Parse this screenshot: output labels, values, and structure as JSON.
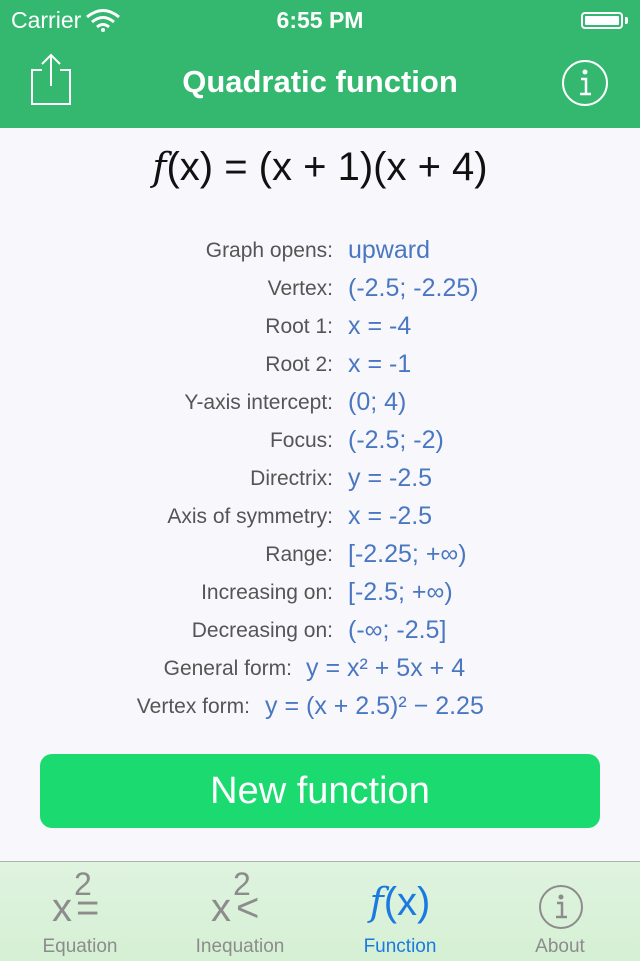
{
  "status_bar": {
    "carrier": "Carrier",
    "time": "6:55 PM",
    "battery_level": 1.0
  },
  "nav": {
    "title": "Quadratic function",
    "left_icon": "share-icon",
    "right_icon": "info-icon"
  },
  "formula": {
    "f": "f",
    "rest": "(x) = (x + 1)(x + 4)"
  },
  "properties": [
    {
      "label": "Graph opens:",
      "value": "upward"
    },
    {
      "label": "Vertex:",
      "value": "(-2.5; -2.25)"
    },
    {
      "label": "Root 1:",
      "value": "x = -4"
    },
    {
      "label": "Root 2:",
      "value": "x = -1"
    },
    {
      "label": "Y-axis intercept:",
      "value": "(0; 4)"
    },
    {
      "label": "Focus:",
      "value": "(-2.5; -2)"
    },
    {
      "label": "Directrix:",
      "value": "y = -2.5"
    },
    {
      "label": "Axis of symmetry:",
      "value": "x = -2.5"
    },
    {
      "label": "Range:",
      "value": "[-2.25; +∞)"
    },
    {
      "label": "Increasing on:",
      "value": "[-2.5; +∞)"
    },
    {
      "label": "Decreasing on:",
      "value": "(-∞; -2.5]"
    },
    {
      "label": "General form:",
      "value": "y = x² + 5x + 4"
    },
    {
      "label": "Vertex form:",
      "value": "y = (x + 2.5)² − 2.25"
    }
  ],
  "new_button": "New function",
  "tabs": [
    {
      "label": "Equation",
      "icon": "x-squared-equals-icon",
      "glyph_base": "x",
      "glyph_sup": "2",
      "glyph_op": "=",
      "active": false
    },
    {
      "label": "Inequation",
      "icon": "x-squared-less-icon",
      "glyph_base": "x",
      "glyph_sup": "2",
      "glyph_op": "<",
      "active": false
    },
    {
      "label": "Function",
      "icon": "fx-icon",
      "glyph_f": "f",
      "glyph_rest": "(x)",
      "active": true
    },
    {
      "label": "About",
      "icon": "info-icon",
      "glyph": "i",
      "active": false
    }
  ],
  "colors": {
    "header": "#34b870",
    "button": "#1bdb70",
    "value_text": "#4a77c2",
    "tab_active": "#1a7ae0",
    "tab_inactive": "#8c8c8c"
  }
}
